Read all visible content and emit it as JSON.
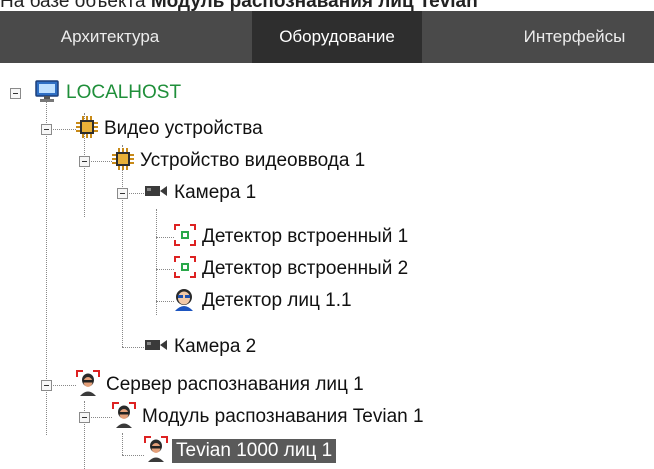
{
  "caption": {
    "prefix": "На базе объекта",
    "bold": "Модуль распознавания лиц Tevian"
  },
  "tabs": [
    {
      "label": "Архитектура",
      "active": false
    },
    {
      "label": "Оборудование",
      "active": true
    },
    {
      "label": "Интерфейсы",
      "active": false
    }
  ],
  "tree": {
    "localhost": "LOCALHOST",
    "video_devices": "Видео устройства",
    "video_input": "Устройство видеоввода 1",
    "camera1": "Камера 1",
    "detector1": "Детектор встроенный 1",
    "detector2": "Детектор встроенный 2",
    "face_detector": "Детектор лиц 1.1",
    "camera2": "Камера 2",
    "face_server": "Сервер распознавания лиц 1",
    "tevian_module": "Модуль распознавания Tevian 1",
    "tevian_item": "Tevian 1000 лиц 1"
  },
  "colors": {
    "tab_bar": "#4a4a4a",
    "tab_active": "#2e2e2e",
    "host_label": "#1f8f3a",
    "selection": "#5a5a5a"
  },
  "icons": [
    "computer-icon",
    "chip-icon",
    "camera-icon",
    "detector-icon",
    "face-detector-icon",
    "face-server-icon"
  ]
}
